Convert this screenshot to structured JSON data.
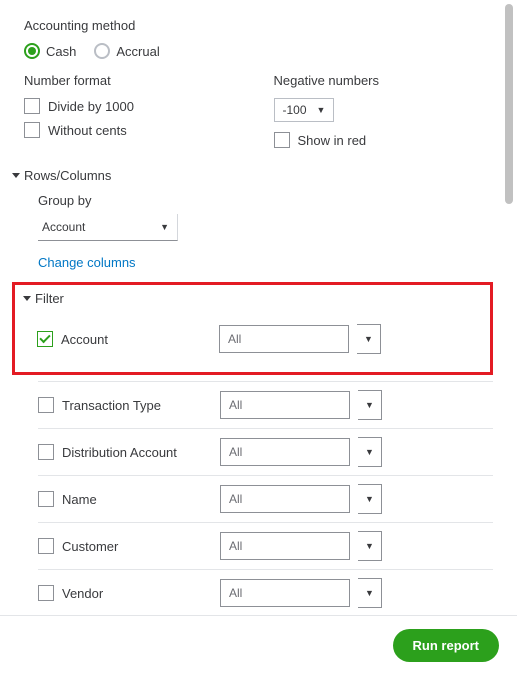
{
  "accounting_method": {
    "title": "Accounting method",
    "options": {
      "cash": "Cash",
      "accrual": "Accrual"
    }
  },
  "number_format": {
    "title": "Number format",
    "divide": "Divide by 1000",
    "without_cents": "Without cents"
  },
  "negative_numbers": {
    "title": "Negative numbers",
    "value": "-100",
    "show_in_red": "Show in red"
  },
  "rows_columns": {
    "title": "Rows/Columns",
    "group_by_label": "Group by",
    "group_by_value": "Account",
    "change_columns": "Change columns"
  },
  "filter": {
    "title": "Filter",
    "items": [
      {
        "label": "Account",
        "value": "All",
        "checked": true
      },
      {
        "label": "Transaction Type",
        "value": "All",
        "checked": false
      },
      {
        "label": "Distribution Account",
        "value": "All",
        "checked": false
      },
      {
        "label": "Name",
        "value": "All",
        "checked": false
      },
      {
        "label": "Customer",
        "value": "All",
        "checked": false
      },
      {
        "label": "Vendor",
        "value": "All",
        "checked": false
      }
    ]
  },
  "footer": {
    "run": "Run report"
  }
}
